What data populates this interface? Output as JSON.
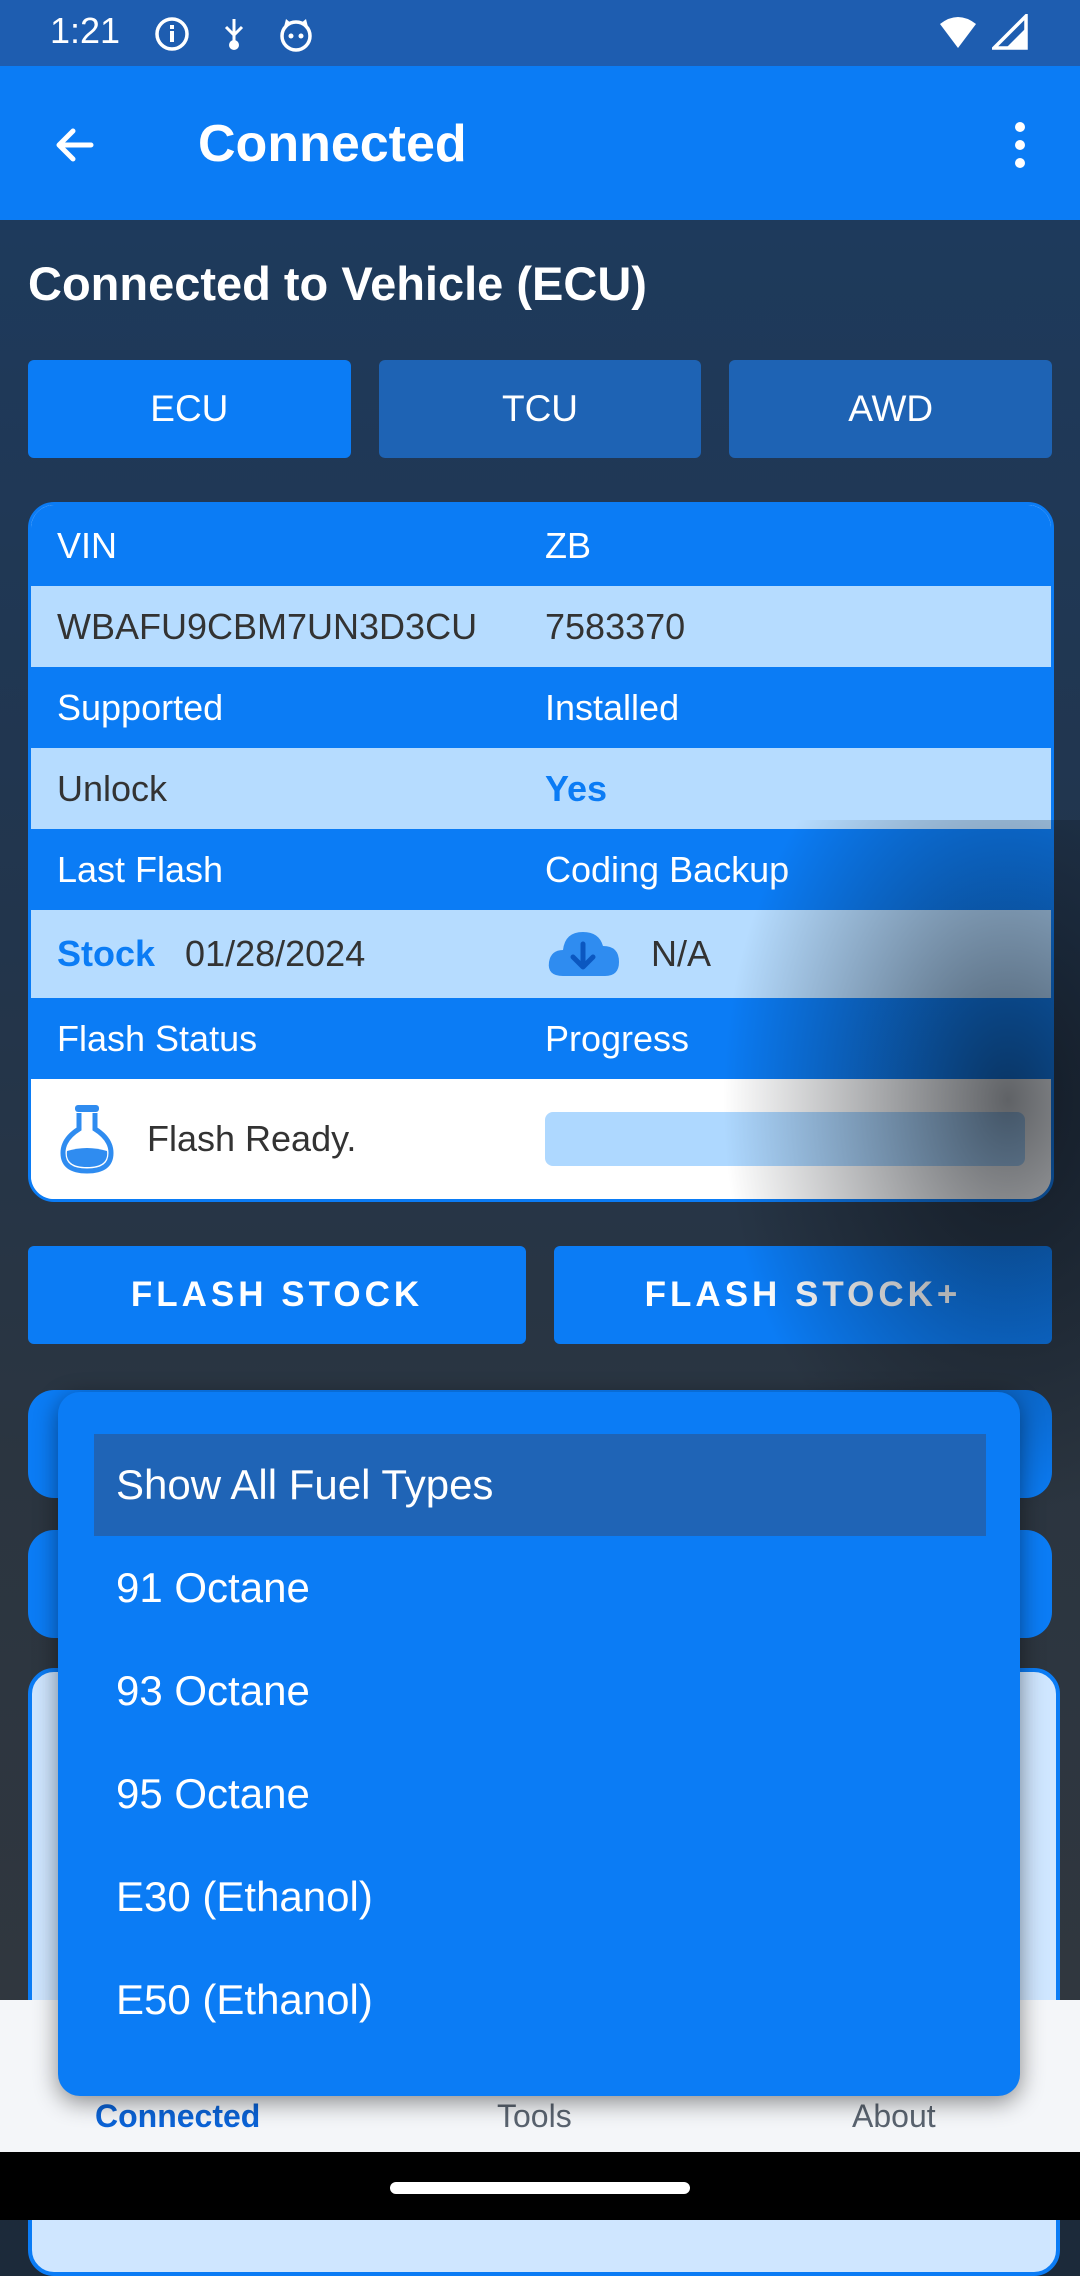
{
  "status_bar": {
    "time": "1:21",
    "left_icons": [
      "info-icon",
      "usb-debug-icon",
      "cat-face-icon"
    ],
    "right_icons": [
      "wifi-icon",
      "signal-icon"
    ]
  },
  "app_bar": {
    "title": "Connected",
    "back_icon": "arrow-back-icon",
    "menu_icon": "more-vert-icon"
  },
  "heading": "Connected to Vehicle (ECU)",
  "module_tabs": [
    {
      "label": "ECU",
      "active": true
    },
    {
      "label": "TCU",
      "active": false
    },
    {
      "label": "AWD",
      "active": false
    }
  ],
  "info_table": {
    "vin_label": "VIN",
    "zb_label": "ZB",
    "vin_value": "WBAFU9CBM7UN3D3CU",
    "zb_value": "7583370",
    "supported_label": "Supported",
    "installed_label": "Installed",
    "unlock_label": "Unlock",
    "unlock_value": "Yes",
    "last_flash_label": "Last Flash",
    "coding_backup_label": "Coding Backup",
    "stock_label": "Stock",
    "stock_date": "01/28/2024",
    "coding_backup_value": "N/A",
    "flash_status_label": "Flash Status",
    "progress_label": "Progress",
    "flash_status_value": "Flash Ready.",
    "progress_value": 0
  },
  "actions": {
    "flash_stock": "FLASH STOCK",
    "flash_stock_plus": "FLASH STOCK+"
  },
  "fuel_dropdown": {
    "options": [
      {
        "label": "Show All Fuel Types",
        "selected": true
      },
      {
        "label": "91 Octane",
        "selected": false
      },
      {
        "label": "93 Octane",
        "selected": false
      },
      {
        "label": "95 Octane",
        "selected": false
      },
      {
        "label": "E30 (Ethanol)",
        "selected": false
      },
      {
        "label": "E50 (Ethanol)",
        "selected": false
      }
    ]
  },
  "bottom_nav": {
    "items": [
      {
        "label": "Connected",
        "active": true
      },
      {
        "label": "Tools",
        "active": false
      },
      {
        "label": "About",
        "active": false
      }
    ]
  },
  "colors": {
    "primary": "#0b7cf5",
    "status_bar": "#1e5db0",
    "row_light": "#b6dcff",
    "accent_text": "#0b7cf5"
  }
}
